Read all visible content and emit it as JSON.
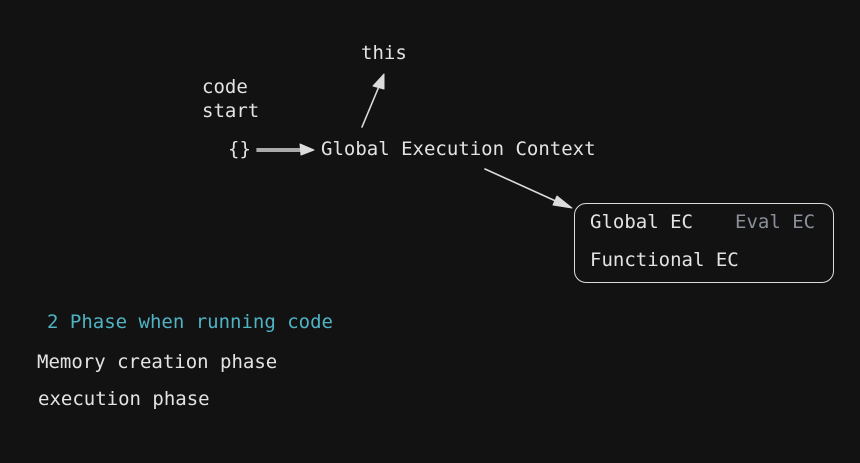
{
  "nodes": {
    "this_label": "this",
    "code_start_line1": "code",
    "code_start_line2": "start",
    "braces": "{}",
    "global_execution_context": "Global Execution Context"
  },
  "ec_box": {
    "global_ec": "Global EC",
    "eval_ec": "Eval EC",
    "functional_ec": "Functional EC"
  },
  "phases": {
    "heading": "2 Phase when running code",
    "items": [
      "Memory creation phase",
      "execution phase"
    ]
  },
  "colors": {
    "background": "#121212",
    "text": "#e3e3e3",
    "heading": "#4fb3c4",
    "muted": "#8a8f99",
    "stroke": "#dcdcdc"
  }
}
